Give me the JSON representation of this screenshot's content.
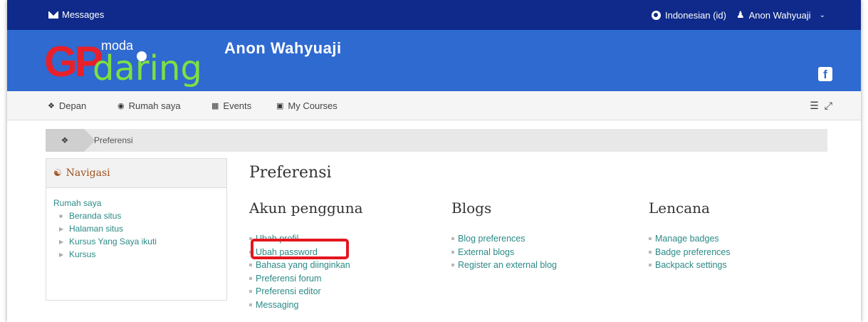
{
  "topbar": {
    "messages_label": "Messages",
    "language_label": "Indonesian (id)",
    "user_label": "Anon Wahyuaji"
  },
  "header": {
    "logo_gp": "GP",
    "logo_moda": "moda",
    "logo_daring": "daring",
    "site_name": "Anon Wahyuaji",
    "facebook_glyph": "f"
  },
  "nav": {
    "items": [
      {
        "label": "Depan",
        "icon": "home-icon"
      },
      {
        "label": "Rumah saya",
        "icon": "dashboard-icon"
      },
      {
        "label": "Events",
        "icon": "calendar-icon"
      },
      {
        "label": "My Courses",
        "icon": "briefcase-icon"
      }
    ]
  },
  "breadcrumb": {
    "current": "Preferensi"
  },
  "navigation_block": {
    "title": "Navigasi",
    "root": "Rumah saya",
    "items": [
      "Beranda situs",
      "Halaman situs",
      "Kursus Yang Saya ikuti",
      "Kursus"
    ]
  },
  "main": {
    "title": "Preferensi",
    "columns": [
      {
        "heading": "Akun pengguna",
        "links": [
          "Ubah profil",
          "Ubah password",
          "Bahasa yang diinginkan",
          "Preferensi forum",
          "Preferensi editor",
          "Messaging"
        ]
      },
      {
        "heading": "Blogs",
        "links": [
          "Blog preferences",
          "External blogs",
          "Register an external blog"
        ]
      },
      {
        "heading": "Lencana",
        "links": [
          "Manage badges",
          "Badge preferences",
          "Backpack settings"
        ]
      }
    ]
  },
  "colors": {
    "topbar": "#0f2a8a",
    "header": "#2f6ad0",
    "link": "#2a8a86",
    "highlight": "#e5161f"
  }
}
